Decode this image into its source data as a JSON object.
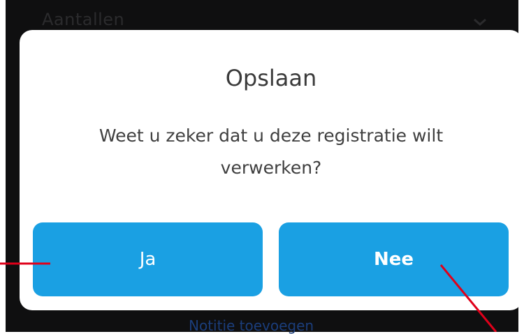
{
  "background": {
    "top_label": "Aantallen",
    "bottom_link": "Notitie toevoegen"
  },
  "dialog": {
    "title": "Opslaan",
    "message": "Weet u zeker dat u deze registratie wilt verwerken?",
    "yes_label": "Ja",
    "no_label": "Nee"
  },
  "colors": {
    "button": "#1aa0e3",
    "background_dark": "#0f0f10",
    "annotation": "#e0001a"
  },
  "icons": {
    "background_chevron": "chevron-down-icon"
  }
}
